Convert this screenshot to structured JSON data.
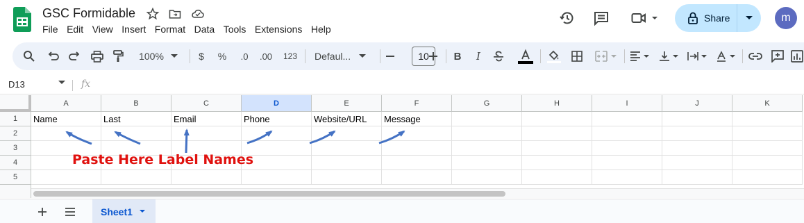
{
  "app": {
    "title": "GSC Formidable",
    "menu": [
      "File",
      "Edit",
      "View",
      "Insert",
      "Format",
      "Data",
      "Tools",
      "Extensions",
      "Help"
    ],
    "share_label": "Share",
    "avatar_letter": "m"
  },
  "toolbar": {
    "zoom": "100%",
    "currency": "$",
    "percent": "%",
    "decrease_decimal": ".0",
    "increase_decimal": ".00",
    "number_format": "123",
    "font": "Defaul...",
    "font_size": "10"
  },
  "formula_bar": {
    "name_box": "D13",
    "fx": "fx"
  },
  "grid": {
    "columns": [
      "A",
      "B",
      "C",
      "D",
      "E",
      "F",
      "G",
      "H",
      "I",
      "J",
      "K"
    ],
    "active_column": "D",
    "rows": [
      "1",
      "2",
      "3",
      "4",
      "5"
    ],
    "row1_cells": [
      "Name",
      "Last",
      "Email",
      "Phone",
      "Website/URL",
      "Message",
      "",
      "",
      "",
      "",
      ""
    ],
    "annotation": "Paste Here Label Names",
    "annotation_color": "#e0110e",
    "arrow_color": "#4472c4"
  },
  "sheets": {
    "tabs": [
      {
        "label": "Sheet1",
        "active": true
      }
    ]
  },
  "colors": {
    "accent": "#0b57d0",
    "share_bg": "#c2e7ff",
    "active_col_bg": "#d3e3fd"
  }
}
